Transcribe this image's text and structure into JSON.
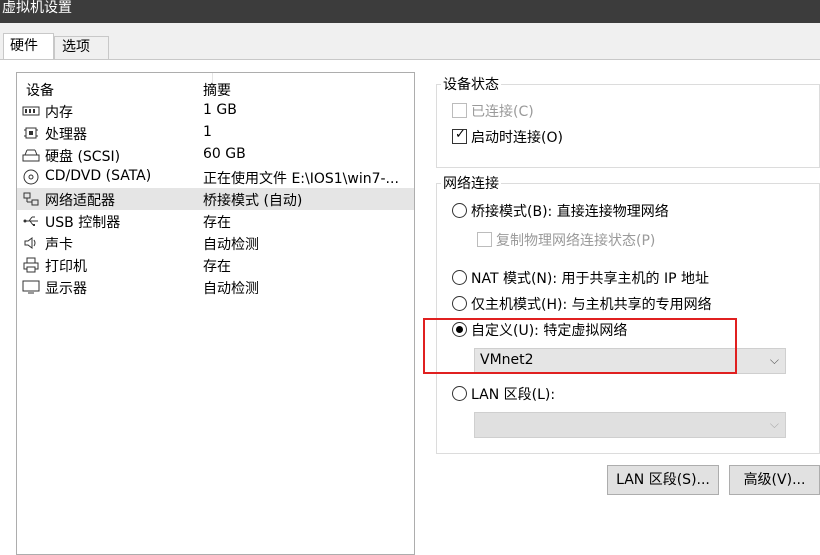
{
  "window": {
    "title": "虚拟机设置"
  },
  "tabs": [
    {
      "label": "硬件"
    },
    {
      "label": "选项"
    }
  ],
  "device_list": {
    "headers": {
      "device": "设备",
      "summary": "摘要"
    },
    "rows": [
      {
        "icon": "memory-icon",
        "name": "内存",
        "summary": "1 GB"
      },
      {
        "icon": "processor-icon",
        "name": "处理器",
        "summary": "1"
      },
      {
        "icon": "harddisk-icon",
        "name": "硬盘 (SCSI)",
        "summary": "60 GB"
      },
      {
        "icon": "cd-dvd-icon",
        "name": "CD/DVD (SATA)",
        "summary": "正在使用文件 E:\\IOS1\\win7-..."
      },
      {
        "icon": "network-adapter-icon",
        "name": "网络适配器",
        "summary": "桥接模式 (自动)"
      },
      {
        "icon": "usb-icon",
        "name": "USB 控制器",
        "summary": "存在"
      },
      {
        "icon": "sound-icon",
        "name": "声卡",
        "summary": "自动检测"
      },
      {
        "icon": "printer-icon",
        "name": "打印机",
        "summary": "存在"
      },
      {
        "icon": "display-icon",
        "name": "显示器",
        "summary": "自动检测"
      }
    ],
    "selected_index": 4
  },
  "device_status": {
    "title": "设备状态",
    "connected_label": "已连接(C)",
    "connect_at_power_on_label": "启动时连接(O)"
  },
  "network": {
    "title": "网络连接",
    "bridged_label": "桥接模式(B): 直接连接物理网络",
    "replicate_label": "复制物理网络连接状态(P)",
    "nat_label": "NAT 模式(N): 用于共享主机的 IP 地址",
    "hostonly_label": "仅主机模式(H): 与主机共享的专用网络",
    "custom_label": "自定义(U): 特定虚拟网络",
    "custom_selected": "VMnet2",
    "lan_label": "LAN 区段(L):",
    "lan_selected": ""
  },
  "buttons": {
    "lan_segments": "LAN 区段(S)...",
    "advanced": "高级(V)..."
  },
  "colors": {
    "highlight": "#e02020",
    "selection": "#e5e5e5"
  }
}
